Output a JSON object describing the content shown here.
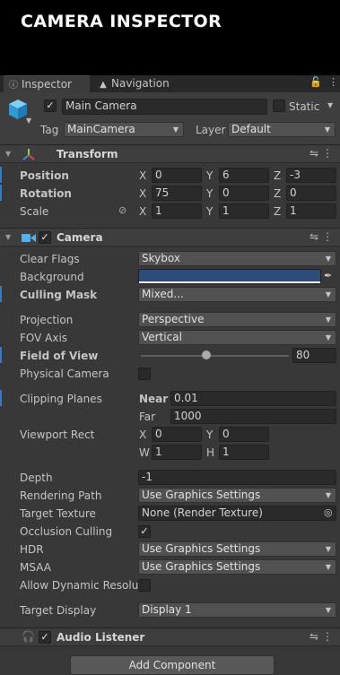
{
  "page_title": "CAMERA INSPECTOR",
  "tabs": [
    {
      "label": "Inspector",
      "active": true
    },
    {
      "label": "Navigation",
      "active": false
    }
  ],
  "gameobject": {
    "active": true,
    "name": "Main Camera",
    "static_label": "Static",
    "tag_label": "Tag",
    "tag_value": "MainCamera",
    "layer_label": "Layer",
    "layer_value": "Default"
  },
  "transform": {
    "title": "Transform",
    "position": {
      "label": "Position",
      "x": "0",
      "y": "6",
      "z": "-3"
    },
    "rotation": {
      "label": "Rotation",
      "x": "75",
      "y": "0",
      "z": "0"
    },
    "scale": {
      "label": "Scale",
      "x": "1",
      "y": "1",
      "z": "1"
    }
  },
  "camera": {
    "title": "Camera",
    "enabled": true,
    "clear_flags": {
      "label": "Clear Flags",
      "value": "Skybox"
    },
    "background": {
      "label": "Background",
      "color": "#2c4c7c"
    },
    "culling_mask": {
      "label": "Culling Mask",
      "value": "Mixed..."
    },
    "projection": {
      "label": "Projection",
      "value": "Perspective"
    },
    "fov_axis": {
      "label": "FOV Axis",
      "value": "Vertical"
    },
    "field_of_view": {
      "label": "Field of View",
      "value": "80"
    },
    "physical_camera": {
      "label": "Physical Camera",
      "checked": false
    },
    "clipping_planes": {
      "label": "Clipping Planes",
      "near_label": "Near",
      "near": "0.01",
      "far_label": "Far",
      "far": "1000"
    },
    "viewport_rect": {
      "label": "Viewport Rect",
      "x": "0",
      "y": "0",
      "w": "1",
      "h": "1"
    },
    "depth": {
      "label": "Depth",
      "value": "-1"
    },
    "rendering_path": {
      "label": "Rendering Path",
      "value": "Use Graphics Settings"
    },
    "target_texture": {
      "label": "Target Texture",
      "value": "None (Render Texture)"
    },
    "occlusion_culling": {
      "label": "Occlusion Culling",
      "checked": true
    },
    "hdr": {
      "label": "HDR",
      "value": "Use Graphics Settings"
    },
    "msaa": {
      "label": "MSAA",
      "value": "Use Graphics Settings"
    },
    "allow_dynamic_resolution": {
      "label": "Allow Dynamic Resolut",
      "checked": false
    },
    "target_display": {
      "label": "Target Display",
      "value": "Display 1"
    }
  },
  "audio_listener": {
    "title": "Audio Listener",
    "enabled": true
  },
  "add_component_label": "Add Component",
  "axis_labels": {
    "x": "X",
    "y": "Y",
    "z": "Z",
    "w": "W",
    "h": "H"
  },
  "colors": {
    "accent_blue": "#3a79bb",
    "panel_bg": "#383838",
    "camera_icon": "#4fb3e8"
  }
}
